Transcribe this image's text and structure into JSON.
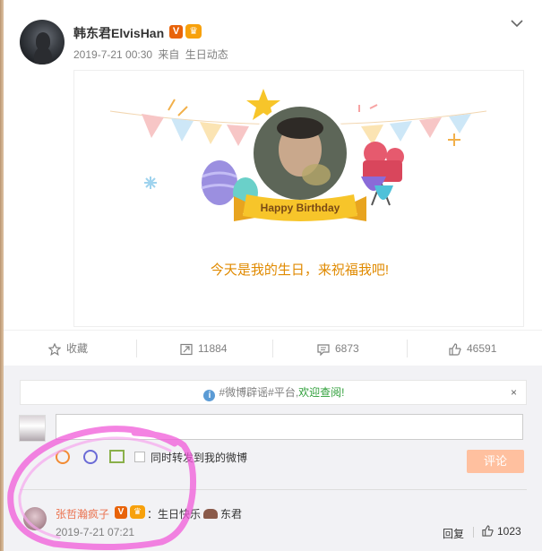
{
  "post": {
    "username": "韩东君ElvisHan",
    "verified_badge": "V",
    "crown_badge": "crown",
    "date": "2019-7-21 00:30",
    "source_prefix": "来自",
    "source": "生日动态",
    "menu_icon": "chevron-down-icon"
  },
  "birthday_card": {
    "banner": "Happy Birthday",
    "message": "今天是我的生日，来祝福我吧!"
  },
  "actions": {
    "favorite_label": "收藏",
    "repost_count": "11884",
    "comment_count": "6873",
    "like_count": "46591"
  },
  "comment_box": {
    "notice_prefix": "#微博辟谣#平台,",
    "notice_link": "欢迎查阅!",
    "notice_close": "×",
    "sync_label": "同时转发到我的微博",
    "submit_label": "评论"
  },
  "comment": {
    "name": "张哲瀚疯子",
    "text_before": "：生日快乐",
    "text_after": "东君",
    "time": "2019-7-21 07:21",
    "reply_label": "回复",
    "like_count": "1023"
  },
  "colors": {
    "accent_orange": "#eb7350",
    "birthday_text": "#e08a00",
    "notice_green": "#2f9f3a",
    "highlight_pink": "#f05ad8"
  }
}
